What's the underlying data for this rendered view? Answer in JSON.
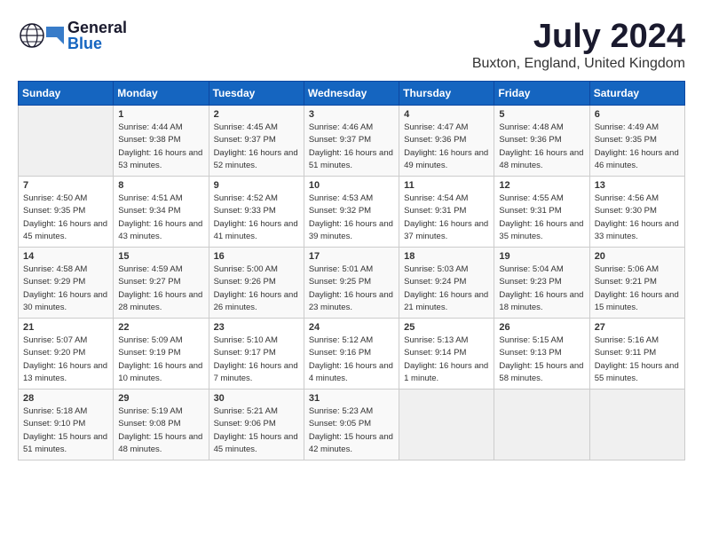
{
  "header": {
    "logo": {
      "general": "General",
      "blue": "Blue"
    },
    "title": "July 2024",
    "location": "Buxton, England, United Kingdom"
  },
  "days_of_week": [
    "Sunday",
    "Monday",
    "Tuesday",
    "Wednesday",
    "Thursday",
    "Friday",
    "Saturday"
  ],
  "weeks": [
    [
      {
        "day": "",
        "sunrise": "",
        "sunset": "",
        "daylight": ""
      },
      {
        "day": "1",
        "sunrise": "Sunrise: 4:44 AM",
        "sunset": "Sunset: 9:38 PM",
        "daylight": "Daylight: 16 hours and 53 minutes."
      },
      {
        "day": "2",
        "sunrise": "Sunrise: 4:45 AM",
        "sunset": "Sunset: 9:37 PM",
        "daylight": "Daylight: 16 hours and 52 minutes."
      },
      {
        "day": "3",
        "sunrise": "Sunrise: 4:46 AM",
        "sunset": "Sunset: 9:37 PM",
        "daylight": "Daylight: 16 hours and 51 minutes."
      },
      {
        "day": "4",
        "sunrise": "Sunrise: 4:47 AM",
        "sunset": "Sunset: 9:36 PM",
        "daylight": "Daylight: 16 hours and 49 minutes."
      },
      {
        "day": "5",
        "sunrise": "Sunrise: 4:48 AM",
        "sunset": "Sunset: 9:36 PM",
        "daylight": "Daylight: 16 hours and 48 minutes."
      },
      {
        "day": "6",
        "sunrise": "Sunrise: 4:49 AM",
        "sunset": "Sunset: 9:35 PM",
        "daylight": "Daylight: 16 hours and 46 minutes."
      }
    ],
    [
      {
        "day": "7",
        "sunrise": "Sunrise: 4:50 AM",
        "sunset": "Sunset: 9:35 PM",
        "daylight": "Daylight: 16 hours and 45 minutes."
      },
      {
        "day": "8",
        "sunrise": "Sunrise: 4:51 AM",
        "sunset": "Sunset: 9:34 PM",
        "daylight": "Daylight: 16 hours and 43 minutes."
      },
      {
        "day": "9",
        "sunrise": "Sunrise: 4:52 AM",
        "sunset": "Sunset: 9:33 PM",
        "daylight": "Daylight: 16 hours and 41 minutes."
      },
      {
        "day": "10",
        "sunrise": "Sunrise: 4:53 AM",
        "sunset": "Sunset: 9:32 PM",
        "daylight": "Daylight: 16 hours and 39 minutes."
      },
      {
        "day": "11",
        "sunrise": "Sunrise: 4:54 AM",
        "sunset": "Sunset: 9:31 PM",
        "daylight": "Daylight: 16 hours and 37 minutes."
      },
      {
        "day": "12",
        "sunrise": "Sunrise: 4:55 AM",
        "sunset": "Sunset: 9:31 PM",
        "daylight": "Daylight: 16 hours and 35 minutes."
      },
      {
        "day": "13",
        "sunrise": "Sunrise: 4:56 AM",
        "sunset": "Sunset: 9:30 PM",
        "daylight": "Daylight: 16 hours and 33 minutes."
      }
    ],
    [
      {
        "day": "14",
        "sunrise": "Sunrise: 4:58 AM",
        "sunset": "Sunset: 9:29 PM",
        "daylight": "Daylight: 16 hours and 30 minutes."
      },
      {
        "day": "15",
        "sunrise": "Sunrise: 4:59 AM",
        "sunset": "Sunset: 9:27 PM",
        "daylight": "Daylight: 16 hours and 28 minutes."
      },
      {
        "day": "16",
        "sunrise": "Sunrise: 5:00 AM",
        "sunset": "Sunset: 9:26 PM",
        "daylight": "Daylight: 16 hours and 26 minutes."
      },
      {
        "day": "17",
        "sunrise": "Sunrise: 5:01 AM",
        "sunset": "Sunset: 9:25 PM",
        "daylight": "Daylight: 16 hours and 23 minutes."
      },
      {
        "day": "18",
        "sunrise": "Sunrise: 5:03 AM",
        "sunset": "Sunset: 9:24 PM",
        "daylight": "Daylight: 16 hours and 21 minutes."
      },
      {
        "day": "19",
        "sunrise": "Sunrise: 5:04 AM",
        "sunset": "Sunset: 9:23 PM",
        "daylight": "Daylight: 16 hours and 18 minutes."
      },
      {
        "day": "20",
        "sunrise": "Sunrise: 5:06 AM",
        "sunset": "Sunset: 9:21 PM",
        "daylight": "Daylight: 16 hours and 15 minutes."
      }
    ],
    [
      {
        "day": "21",
        "sunrise": "Sunrise: 5:07 AM",
        "sunset": "Sunset: 9:20 PM",
        "daylight": "Daylight: 16 hours and 13 minutes."
      },
      {
        "day": "22",
        "sunrise": "Sunrise: 5:09 AM",
        "sunset": "Sunset: 9:19 PM",
        "daylight": "Daylight: 16 hours and 10 minutes."
      },
      {
        "day": "23",
        "sunrise": "Sunrise: 5:10 AM",
        "sunset": "Sunset: 9:17 PM",
        "daylight": "Daylight: 16 hours and 7 minutes."
      },
      {
        "day": "24",
        "sunrise": "Sunrise: 5:12 AM",
        "sunset": "Sunset: 9:16 PM",
        "daylight": "Daylight: 16 hours and 4 minutes."
      },
      {
        "day": "25",
        "sunrise": "Sunrise: 5:13 AM",
        "sunset": "Sunset: 9:14 PM",
        "daylight": "Daylight: 16 hours and 1 minute."
      },
      {
        "day": "26",
        "sunrise": "Sunrise: 5:15 AM",
        "sunset": "Sunset: 9:13 PM",
        "daylight": "Daylight: 15 hours and 58 minutes."
      },
      {
        "day": "27",
        "sunrise": "Sunrise: 5:16 AM",
        "sunset": "Sunset: 9:11 PM",
        "daylight": "Daylight: 15 hours and 55 minutes."
      }
    ],
    [
      {
        "day": "28",
        "sunrise": "Sunrise: 5:18 AM",
        "sunset": "Sunset: 9:10 PM",
        "daylight": "Daylight: 15 hours and 51 minutes."
      },
      {
        "day": "29",
        "sunrise": "Sunrise: 5:19 AM",
        "sunset": "Sunset: 9:08 PM",
        "daylight": "Daylight: 15 hours and 48 minutes."
      },
      {
        "day": "30",
        "sunrise": "Sunrise: 5:21 AM",
        "sunset": "Sunset: 9:06 PM",
        "daylight": "Daylight: 15 hours and 45 minutes."
      },
      {
        "day": "31",
        "sunrise": "Sunrise: 5:23 AM",
        "sunset": "Sunset: 9:05 PM",
        "daylight": "Daylight: 15 hours and 42 minutes."
      },
      {
        "day": "",
        "sunrise": "",
        "sunset": "",
        "daylight": ""
      },
      {
        "day": "",
        "sunrise": "",
        "sunset": "",
        "daylight": ""
      },
      {
        "day": "",
        "sunrise": "",
        "sunset": "",
        "daylight": ""
      }
    ]
  ]
}
